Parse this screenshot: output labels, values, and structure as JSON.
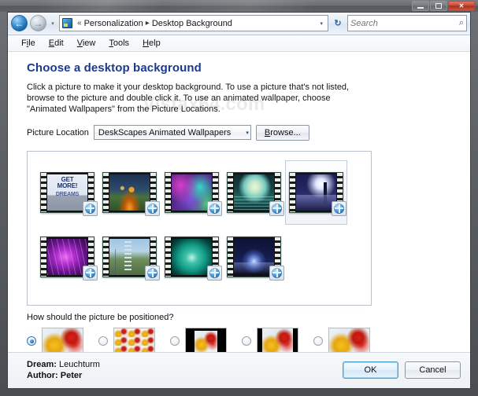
{
  "window": {
    "controls": {
      "minimize": "–",
      "maximize": "□",
      "close": "✕"
    }
  },
  "addressbar": {
    "back_icon": "←",
    "forward_icon": "→",
    "history_icon": "▾",
    "breadcrumb_prefix": "«",
    "breadcrumb": [
      "Personalization",
      "Desktop Background"
    ],
    "separator": "▸",
    "dropdown_icon": "▾",
    "refresh_icon": "↻",
    "search": {
      "placeholder": "Search",
      "value": "",
      "icon": "⌕"
    }
  },
  "menubar": {
    "items": [
      {
        "pre": "F",
        "key": "i",
        "post": "le",
        "label": "File"
      },
      {
        "pre": "",
        "key": "E",
        "post": "dit",
        "label": "Edit"
      },
      {
        "pre": "",
        "key": "V",
        "post": "iew",
        "label": "View"
      },
      {
        "pre": "",
        "key": "T",
        "post": "ools",
        "label": "Tools"
      },
      {
        "pre": "",
        "key": "H",
        "post": "elp",
        "label": "Help"
      }
    ]
  },
  "watermark": "Vistax64.com",
  "main": {
    "title": "Choose a desktop background",
    "description": "Click a picture to make it your desktop background. To use a picture that's not listed, browse to the picture and double click it. To use an animated wallpaper, choose \"Animated Wallpapers\" from the Picture Locations.",
    "picture_location": {
      "label": "Picture Location",
      "value": "DeskScapes Animated Wallpapers",
      "arrow_icon": "▾",
      "browse_pre": "",
      "browse_key": "B",
      "browse_post": "rowse...",
      "browse_label": "Browse..."
    },
    "gallery": {
      "rows": [
        [
          {
            "name": "Get More Dreams",
            "art": "art-getmore",
            "selected": false,
            "line1": "GET",
            "line2": "MORE!",
            "line3": "DREAMS"
          },
          {
            "name": "Halloween Pumpkins",
            "art": "art-halloween",
            "selected": false
          },
          {
            "name": "Colorful Nebula",
            "art": "art-nebula",
            "selected": false
          },
          {
            "name": "Moon Over Sea",
            "art": "art-moonsea",
            "selected": false
          },
          {
            "name": "Leuchturm",
            "art": "art-night",
            "selected": true
          }
        ],
        [
          {
            "name": "Purple Lightning",
            "art": "art-lightning",
            "selected": false
          },
          {
            "name": "Roller Coaster",
            "art": "art-coaster",
            "selected": false
          },
          {
            "name": "Teal Orb",
            "art": "art-orb",
            "selected": false
          },
          {
            "name": "Moonrise Over Water",
            "art": "art-moonrise",
            "selected": false
          }
        ]
      ]
    },
    "positioning": {
      "question": "How should the picture be positioned?",
      "options": [
        {
          "name": "stretch",
          "selected": true,
          "style": "stretch"
        },
        {
          "name": "tile",
          "selected": false,
          "style": "tile"
        },
        {
          "name": "center",
          "selected": false,
          "style": "center"
        },
        {
          "name": "fit",
          "selected": false,
          "style": "fit"
        },
        {
          "name": "fill",
          "selected": false,
          "style": "stretch"
        }
      ]
    }
  },
  "footer": {
    "dream_label": "Dream:",
    "dream_value": "Leuchturm",
    "author_label": "Author:",
    "author_value": "Peter",
    "ok_label": "OK",
    "cancel_label": "Cancel"
  },
  "colors": {
    "title_blue": "#1b3a8c",
    "accent_blue": "#2f74b6",
    "close_red": "#c44632"
  }
}
